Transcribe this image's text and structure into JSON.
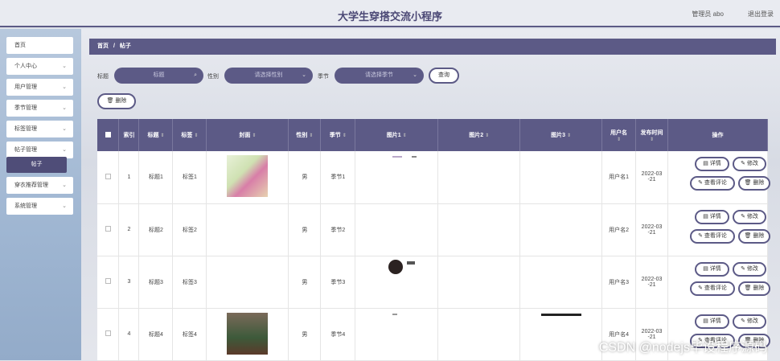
{
  "header": {
    "title": "大学生穿搭交流小程序",
    "user": "管理员 abo",
    "logout": "退出登录"
  },
  "sidebar": {
    "items": [
      {
        "label": "首页",
        "has_chevron": false
      },
      {
        "label": "个人中心",
        "has_chevron": true
      },
      {
        "label": "用户管理",
        "has_chevron": true
      },
      {
        "label": "季节管理",
        "has_chevron": true
      },
      {
        "label": "标签管理",
        "has_chevron": true
      },
      {
        "label": "帖子管理",
        "has_chevron": true
      },
      {
        "label": "穿衣推荐管理",
        "has_chevron": true
      },
      {
        "label": "系统管理",
        "has_chevron": true
      }
    ],
    "active_sub": "帖子"
  },
  "breadcrumb": {
    "home": "首页",
    "sep": "/",
    "current": "帖子"
  },
  "filters": {
    "title_label": "标题",
    "title_placeholder": "标题",
    "gender_label": "性别",
    "gender_placeholder": "请选择性别",
    "season_label": "季节",
    "season_placeholder": "请选择季节",
    "query_button": "查询",
    "delete_button": "删除"
  },
  "table": {
    "headers": [
      "索引",
      "标题",
      "标签",
      "封面",
      "性别",
      "季节",
      "图片1",
      "图片2",
      "图片3",
      "用户名",
      "发布时间",
      "操作"
    ],
    "rows": [
      {
        "index": "1",
        "title": "标题1",
        "tag": "标签1",
        "cover": "photo-two-girls",
        "gender": "男",
        "season": "季节1",
        "username": "用户名1",
        "date": "2022-03\n-21"
      },
      {
        "index": "2",
        "title": "标题2",
        "tag": "标签2",
        "cover": "",
        "gender": "男",
        "season": "季节2",
        "username": "用户名2",
        "date": "2022-03\n-21"
      },
      {
        "index": "3",
        "title": "标题3",
        "tag": "标签3",
        "cover": "",
        "gender": "男",
        "season": "季节3",
        "username": "用户名3",
        "date": "2022-03\n-21"
      },
      {
        "index": "4",
        "title": "标题4",
        "tag": "标签4",
        "cover": "photo-dress",
        "gender": "男",
        "season": "季节4",
        "username": "用户名4",
        "date": "2022-03\n-21"
      }
    ],
    "actions": {
      "detail": "详情",
      "edit": "修改",
      "comments": "查看评论",
      "delete": "删除"
    }
  },
  "watermark": "CSDN @nodejs毕设程序源码",
  "colors": {
    "accent": "#5c5a86",
    "header_text": "#4b4875"
  }
}
